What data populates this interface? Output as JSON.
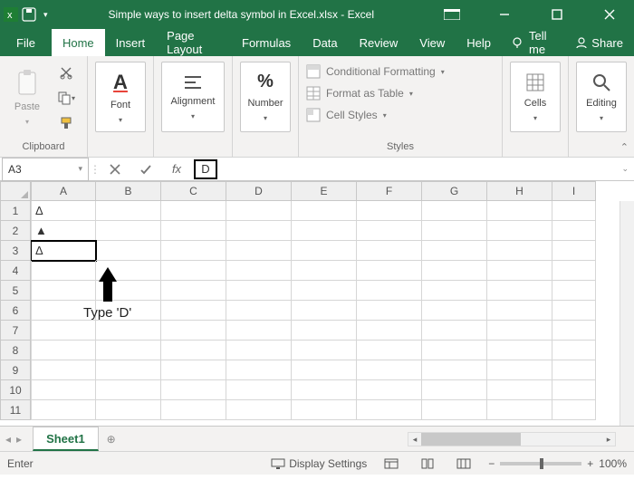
{
  "titlebar": {
    "title": "Simple ways to insert delta symbol in Excel.xlsx  -  Excel"
  },
  "tabs": {
    "file": "File",
    "home": "Home",
    "insert": "Insert",
    "page_layout": "Page Layout",
    "formulas": "Formulas",
    "data": "Data",
    "review": "Review",
    "view": "View",
    "help": "Help",
    "tell_me": "Tell me",
    "share": "Share"
  },
  "ribbon": {
    "clipboard": {
      "paste": "Paste",
      "label": "Clipboard"
    },
    "font": {
      "btn": "Font",
      "glyph": "A"
    },
    "alignment": {
      "btn": "Alignment"
    },
    "number": {
      "btn": "Number",
      "glyph": "%"
    },
    "styles": {
      "conditional": "Conditional Formatting",
      "table": "Format as Table",
      "cellstyles": "Cell Styles",
      "label": "Styles"
    },
    "cells": {
      "btn": "Cells"
    },
    "editing": {
      "btn": "Editing"
    }
  },
  "formula_bar": {
    "name_box": "A3",
    "fx": "fx",
    "value": "D"
  },
  "grid": {
    "columns": [
      "A",
      "B",
      "C",
      "D",
      "E",
      "F",
      "G",
      "H",
      "I"
    ],
    "rows": [
      "1",
      "2",
      "3",
      "4",
      "5",
      "6",
      "7",
      "8",
      "9",
      "10",
      "11"
    ],
    "cells": {
      "A1": "Δ",
      "A2": "▲",
      "A3": "Δ"
    },
    "editing_cell": "A3"
  },
  "annotation": {
    "text": "Type 'D'"
  },
  "sheets": {
    "active": "Sheet1"
  },
  "statusbar": {
    "mode": "Enter",
    "display_settings": "Display Settings",
    "zoom_pct": "100%"
  }
}
